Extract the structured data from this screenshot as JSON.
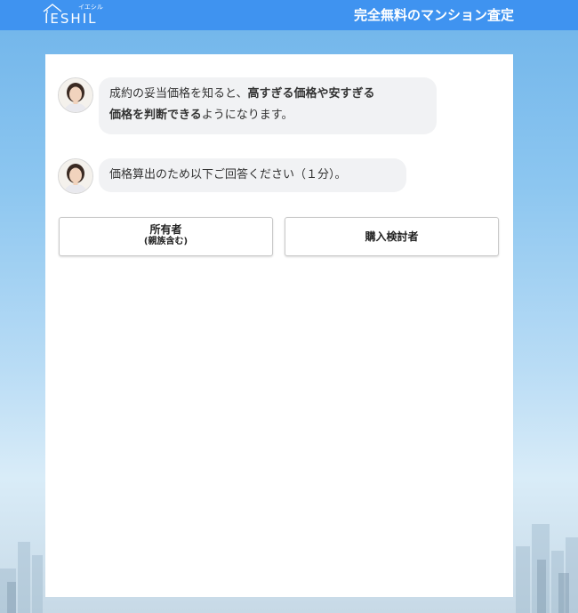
{
  "header": {
    "logo_text": "IESHIL",
    "logo_kana": "イエシル",
    "title": "完全無料のマンション査定"
  },
  "chat": {
    "messages": [
      {
        "avatar": "operator-avatar",
        "line1_normal": "成約の妥当価格を知ると、",
        "line1_bold": "高すぎる価格や安すぎる",
        "line2_bold": "価格を判断できる",
        "line2_normal": "ようになります。"
      },
      {
        "avatar": "operator-avatar",
        "text": "価格算出のため以下ご回答ください（１分）。"
      }
    ]
  },
  "choices": {
    "owner_label": "所有者",
    "owner_sub": "(親族含む)",
    "buyer_label": "購入検討者"
  },
  "colors": {
    "header_bg": "#3f93f0",
    "bubble_bg": "#f1f2f4",
    "card_bg": "#ffffff"
  }
}
